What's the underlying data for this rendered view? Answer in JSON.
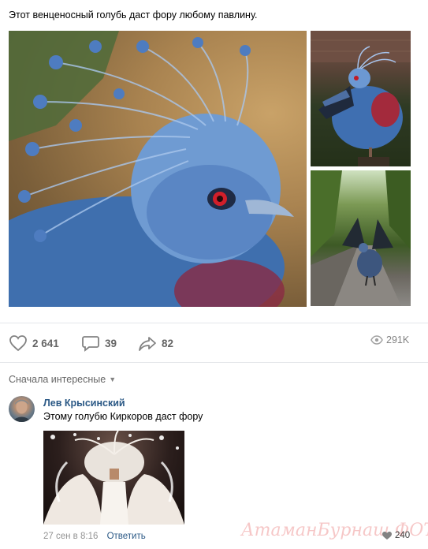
{
  "post": {
    "text": "Этот венценосный голубь даст фору любому павлину."
  },
  "actions": {
    "likes": "2 641",
    "comments": "39",
    "shares": "82",
    "views": "291K"
  },
  "comments_section": {
    "sort_label": "Сначала интересные",
    "comment": {
      "author": "Лев Крысинский",
      "text": "Этому голубю Киркоров даст фору",
      "date": "27 сен в 8:16",
      "reply_label": "Ответить",
      "likes": "240"
    }
  },
  "watermark": "АтаманБурнаш ФОТО.RU",
  "colors": {
    "link": "#2a5885",
    "icon": "#828282",
    "divider": "#e4e6ea"
  },
  "icons": [
    "heart-icon",
    "comment-icon",
    "share-icon",
    "eye-icon",
    "chevron-down-icon"
  ]
}
